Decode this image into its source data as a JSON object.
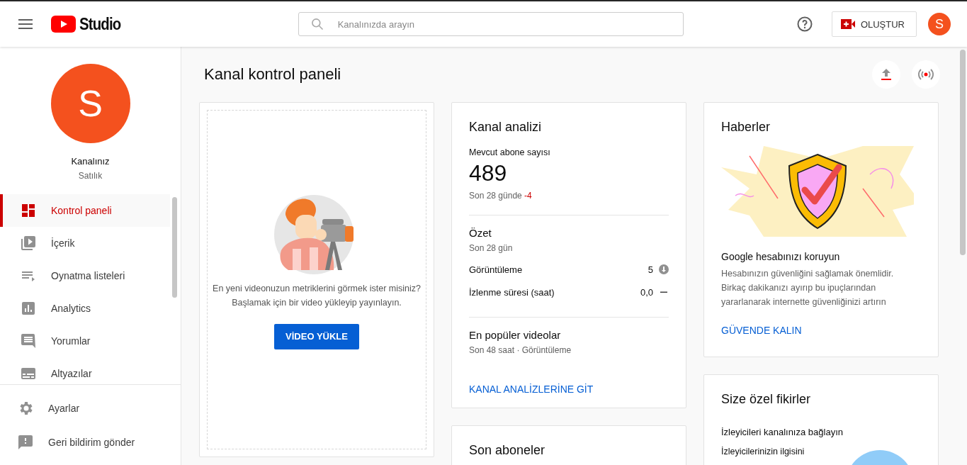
{
  "topbar": {
    "logo_text": "Studio",
    "search": {
      "placeholder": "Kanalınızda arayın"
    },
    "create_button": "OLUŞTUR",
    "avatar_letter": "S"
  },
  "sidebar": {
    "channel": {
      "avatar_letter": "S",
      "name": "Kanalınız",
      "subtitle": "Satılık"
    },
    "items": [
      {
        "label": "Kontrol paneli",
        "kind": "dashboard",
        "selected": true
      },
      {
        "label": "İçerik",
        "kind": "content",
        "selected": false
      },
      {
        "label": "Oynatma listeleri",
        "kind": "playlist",
        "selected": false
      },
      {
        "label": "Analytics",
        "kind": "chart",
        "selected": false
      },
      {
        "label": "Yorumlar",
        "kind": "comment",
        "selected": false
      },
      {
        "label": "Altyazılar",
        "kind": "subtitles",
        "selected": false
      }
    ],
    "footer_items": [
      {
        "label": "Ayarlar",
        "kind": "gear"
      },
      {
        "label": "Geri bildirim gönder",
        "kind": "feedback"
      }
    ]
  },
  "page": {
    "title": "Kanal kontrol paneli"
  },
  "upload_card": {
    "text": "En yeni videonuzun metriklerini görmek ister misiniz? Başlamak için bir video yükleyip yayınlayın.",
    "button": "VİDEO YÜKLE"
  },
  "analytics_card": {
    "title": "Kanal analizi",
    "subscribers_label": "Mevcut abone sayısı",
    "subscribers": "489",
    "period": "Son 28 günde",
    "change": "-4",
    "summary_title": "Özet",
    "summary_period": "Son 28 gün",
    "metrics": [
      {
        "label": "Görüntüleme",
        "value": "5",
        "kind": "down"
      },
      {
        "label": "İzlenme süresi (saat)",
        "value": "0,0",
        "kind": "flat"
      }
    ],
    "top_videos_title": "En popüler videolar",
    "top_videos_subtitle": "Son 48 saat · Görüntüleme",
    "link": "KANAL ANALİZLERİNE GİT"
  },
  "subscribers_card": {
    "title": "Son aboneler"
  },
  "news_card": {
    "title": "Haberler",
    "headline": "Google hesabınızı koruyun",
    "body": "Hesabınızın güvenliğini sağlamak önemlidir. Birkaç dakikanızı ayırıp bu ipuçlarından yararlanarak internette güvenliğinizi artırın",
    "link": "GÜVENDE KALIN"
  },
  "ideas_card": {
    "title": "Size özel fikirler",
    "subtitle": "İzleyicileri kanalınıza bağlayın",
    "body": "İzleyicilerinizin ilgisini"
  }
}
